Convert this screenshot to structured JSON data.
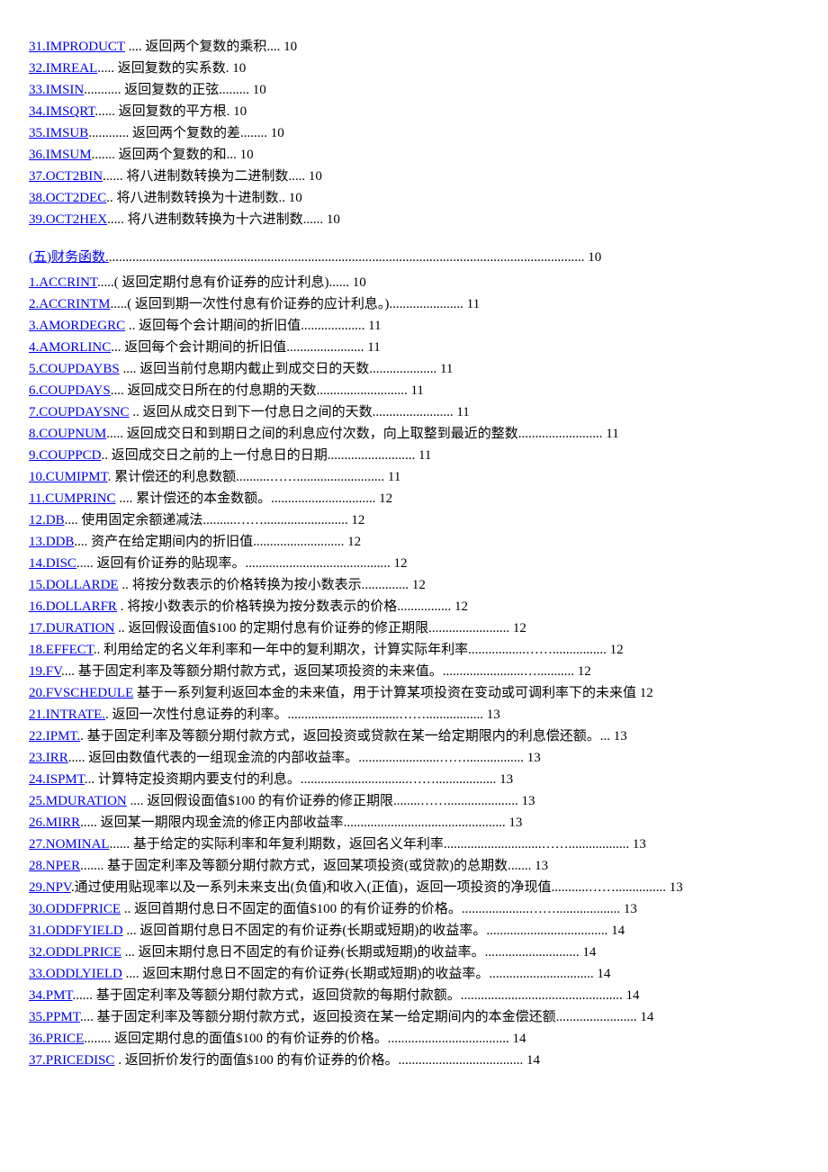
{
  "group1": [
    {
      "link": "31.IMPRODUCT",
      "desc": " .... 返回两个复数的乘积.... 10"
    },
    {
      "link": "32.IMREAL",
      "desc": "..... 返回复数的实系数. 10"
    },
    {
      "link": "33.IMSIN",
      "desc": "........... 返回复数的正弦......... 10"
    },
    {
      "link": "34.IMSQRT",
      "desc": "...... 返回复数的平方根. 10"
    },
    {
      "link": "35.IMSUB",
      "desc": "............ 返回两个复数的差........ 10"
    },
    {
      "link": "36.IMSUM",
      "desc": "....... 返回两个复数的和... 10"
    },
    {
      "link": "37.OCT2BIN",
      "desc": "...... 将八进制数转换为二进制数..... 10"
    },
    {
      "link": "38.OCT2DEC",
      "desc": ".. 将八进制数转换为十进制数.. 10"
    },
    {
      "link": "39.OCT2HEX",
      "desc": "..... 将八进制数转换为十六进制数...... 10"
    }
  ],
  "section": {
    "link": "(五)财务函数.",
    "desc": "............................................................................................................................................. 10"
  },
  "group2": [
    {
      "link": "1.ACCRINT",
      "desc": ".....( 返回定期付息有价证券的应计利息)...... 10"
    },
    {
      "link": "2.ACCRINTM",
      "desc": ".....( 返回到期一次性付息有价证券的应计利息。)...................... 11"
    },
    {
      "link": "3.AMORDEGRC",
      "desc": " .. 返回每个会计期间的折旧值................... 11"
    },
    {
      "link": "4.AMORLINC",
      "desc": "... 返回每个会计期间的折旧值....................... 11"
    },
    {
      "link": "5.COUPDAYBS",
      "desc": " .... 返回当前付息期内截止到成交日的天数.................... 11"
    },
    {
      "link": "6.COUPDAYS",
      "desc": ".... 返回成交日所在的付息期的天数........................... 11"
    },
    {
      "link": "7.COUPDAYSNC",
      "desc": " .. 返回从成交日到下一付息日之间的天数........................ 11"
    },
    {
      "link": "8.COUPNUM",
      "desc": "..... 返回成交日和到期日之间的利息应付次数，向上取整到最近的整数......................... 11"
    },
    {
      "link": "9.COUPPCD",
      "desc": ".. 返回成交日之前的上一付息日的日期.......................... 11"
    },
    {
      "link": "10.CUMIPMT",
      "desc": ". 累计偿还的利息数额..........…….......................... 11"
    },
    {
      "link": "11.CUMPRINC",
      "desc": " .... 累计偿还的本金数额。............................... 12"
    },
    {
      "link": "12.DB",
      "desc": ".... 使用固定余额递减法..........……......................... 12"
    },
    {
      "link": "13.DDB",
      "desc": ".... 资产在给定期间内的折旧值........................... 12"
    },
    {
      "link": "14.DISC",
      "desc": "..... 返回有价证券的贴现率。........................................... 12"
    },
    {
      "link": "15.DOLLARDE",
      "desc": " .. 将按分数表示的价格转换为按小数表示.............. 12"
    },
    {
      "link": "16.DOLLARFR",
      "desc": " . 将按小数表示的价格转换为按分数表示的价格................ 12"
    },
    {
      "link": "17.DURATION",
      "desc": " .. 返回假设面值$100 的定期付息有价证券的修正期限........................ 12"
    },
    {
      "link": "18.EFFECT",
      "desc": ".. 利用给定的名义年利率和一年中的复利期次，计算实际年利率.................……................ 12"
    },
    {
      "link": "19.FV",
      "desc": ".... 基于固定利率及等额分期付款方式，返回某项投资的未来值。........................…........... 12"
    },
    {
      "link": "20.FVSCHEDULE",
      "desc": "   基于一系列复利返回本金的未来值，用于计算某项投资在变动或可调利率下的未来值 12"
    },
    {
      "link": "21.INTRATE.",
      "desc": ". 返回一次性付息证券的利率。.................................……................. 13"
    },
    {
      "link": "22.IPMT.",
      "desc": ". 基于固定利率及等额分期付款方式，返回投资或贷款在某一给定期限内的利息偿还额。... 13"
    },
    {
      "link": "23.IRR",
      "desc": "..... 返回由数值代表的一组现金流的内部收益率。........................……................. 13"
    },
    {
      "link": "24.ISPMT",
      "desc": "... 计算特定投资期内要支付的利息。................................…….................. 13"
    },
    {
      "link": "25.MDURATION",
      "desc": " .... 返回假设面值$100 的有价证券的修正期限........……..................... 13"
    },
    {
      "link": "26.MIRR",
      "desc": "..... 返回某一期限内现金流的修正内部收益率................................................ 13"
    },
    {
      "link": "27.NOMINAL",
      "desc": "...... 基于给定的实际利率和年复利期数，返回名义年利率.............................…….................. 13"
    },
    {
      "link": "28.NPER",
      "desc": "....... 基于固定利率及等额分期付款方式，返回某项投资(或贷款)的总期数....... 13"
    },
    {
      "link": "29.NPV",
      "desc": ".通过使用贴现率以及一系列未来支出(负值)和收入(正值)，返回一项投资的净现值...........……............... 13"
    },
    {
      "link": "30.ODDFPRICE",
      "desc": " .. 返回首期付息日不固定的面值$100 的有价证券的价格。....................……................... 13"
    },
    {
      "link": "31.ODDFYIELD",
      "desc": " ... 返回首期付息日不固定的有价证券(长期或短期)的收益率。.................................... 14"
    },
    {
      "link": "32.ODDLPRICE",
      "desc": " ... 返回末期付息日不固定的有价证券(长期或短期)的收益率。............................ 14"
    },
    {
      "link": "33.ODDLYIELD",
      "desc": " .... 返回末期付息日不固定的有价证券(长期或短期)的收益率。............................... 14"
    },
    {
      "link": "34.PMT",
      "desc": "...... 基于固定利率及等额分期付款方式，返回贷款的每期付款额。................................................ 14"
    },
    {
      "link": "35.PPMT",
      "desc": ".... 基于固定利率及等额分期付款方式，返回投资在某一给定期间内的本金偿还额........................ 14"
    },
    {
      "link": "36.PRICE",
      "desc": "........ 返回定期付息的面值$100 的有价证券的价格。.................................... 14"
    },
    {
      "link": "37.PRICEDISC",
      "desc": " . 返回折价发行的面值$100 的有价证券的价格。..................................... 14"
    }
  ]
}
